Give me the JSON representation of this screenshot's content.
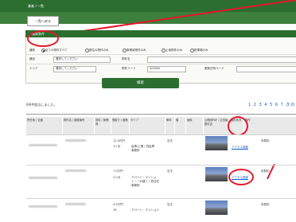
{
  "header": {
    "title": "業者ノー覧",
    "back_button": "一覧へ戻る"
  },
  "search_panel": {
    "title": "検索条件",
    "type_label": "種別",
    "type_options": [
      "全ての物件すべて",
      "居住の物件のみ",
      "事業用物件のみ",
      "土地物件のみ",
      "駐車場のみ"
    ],
    "type_selected": 0,
    "row2_label": "種目",
    "row2_select": "選択してください",
    "row2_label2": "物件名",
    "row3_label": "エリア",
    "row3_select": "選択してください",
    "row3_label2": "物件コード",
    "row3_value2": "000000",
    "row3_label3": "更新日時コード",
    "search_button": "検索"
  },
  "results": {
    "count_text": "6件件該当しました。",
    "pager": "1 2 3 4 5 6 7 次の",
    "headers": [
      "所在地 / 交通",
      "物件名 / 部屋番号",
      "賃料 / 管理費",
      "間取り / 面積",
      "タイプ",
      "築年",
      "階",
      "画像",
      "公開用PDF / 広告転載可否",
      "契約状況",
      "操作"
    ],
    "rows": [
      {
        "price": "12.0万円",
        "layout": "1ヶ月",
        "type": "倉庫/工場 / 貸倉庫事務所",
        "status": "空き",
        "link": "アクセス調査",
        "action": "未契約"
      },
      {
        "price": "7.0万円",
        "layout": "2ヶ月",
        "type": "アパート・マンション・一戸建て / 貸住宅事務所",
        "status": "空き",
        "link": "アクセス調査",
        "action": "未契約"
      },
      {
        "price": "4.5万円",
        "layout": "1R",
        "type": "アパート・マンション",
        "status": "空き",
        "link": "",
        "action": "未契約"
      }
    ]
  },
  "colors": {
    "brand": "#2c6e2f",
    "annotation": "#e3182d",
    "link": "#1a5ec8"
  }
}
